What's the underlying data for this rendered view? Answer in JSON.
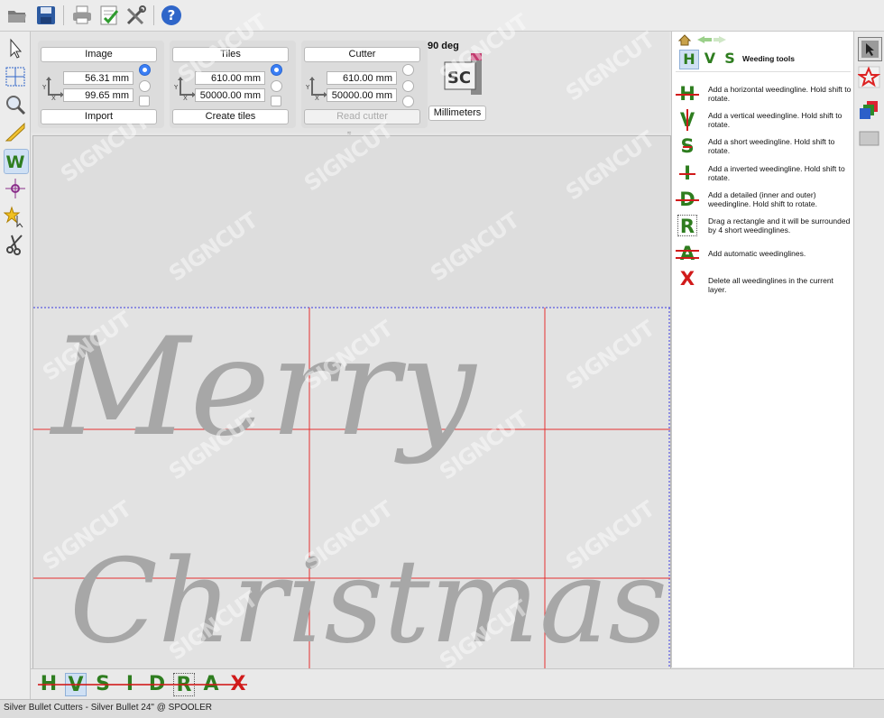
{
  "toolbar": {
    "icons": [
      "open-folder-icon",
      "save-icon",
      "print-icon",
      "checklist-icon",
      "tools-icon",
      "help-icon"
    ]
  },
  "left_tools": [
    "select-arrow-icon",
    "grid-select-icon",
    "zoom-icon",
    "ruler-icon",
    "weeding-icon",
    "crosshair-icon",
    "star-select-icon",
    "scissors-icon"
  ],
  "image_group": {
    "button_label": "Image",
    "field1": "56.31 mm",
    "field2": "99.65 mm",
    "action_label": "Import"
  },
  "tiles_group": {
    "button_label": "Tiles",
    "field1": "610.00 mm",
    "field2": "50000.00 mm",
    "action_label": "Create tiles"
  },
  "cutter_group": {
    "button_label": "Cutter",
    "field1": "610.00 mm",
    "field2": "50000.00 mm",
    "action_label": "Read cutter"
  },
  "rotation": {
    "label": "90 deg",
    "logo_text": "SC",
    "units_label": "Millimeters"
  },
  "canvas": {
    "line1": "Merry",
    "line2": "Christmas"
  },
  "right_panel": {
    "header_letters": [
      "H",
      "V",
      "S"
    ],
    "title": "Weeding tools",
    "items": [
      {
        "letter": "H",
        "text": "Add a horizontal weedingline. Hold shift to rotate."
      },
      {
        "letter": "V",
        "text": "Add a vertical weedingline. Hold shift to rotate."
      },
      {
        "letter": "S",
        "text": "Add a short weedingline. Hold shift to rotate."
      },
      {
        "letter": "I",
        "text": "Add a inverted weedingline. Hold shift to rotate."
      },
      {
        "letter": "D",
        "text": "Add a detailed (inner and outer) weedingline. Hold shift to rotate."
      },
      {
        "letter": "R",
        "text": "Drag a rectangle and it will be surrounded by 4 short weedinglines."
      },
      {
        "letter": "A",
        "text": "Add automatic weedinglines."
      },
      {
        "letter": "X",
        "text": "Delete all weedinglines in the current layer."
      }
    ]
  },
  "bottom_tools": [
    "H",
    "V",
    "S",
    "I",
    "D",
    "R",
    "A",
    "X"
  ],
  "status": {
    "text": "Silver Bullet Cutters - Silver Bullet 24\" @ SPOOLER"
  },
  "watermark": "SIGNCUT",
  "colors": {
    "weed_green": "#2e7d1f",
    "weed_red": "#d11a1a",
    "accent_blue": "#3a7ef5",
    "tile_line": "#e53030"
  }
}
